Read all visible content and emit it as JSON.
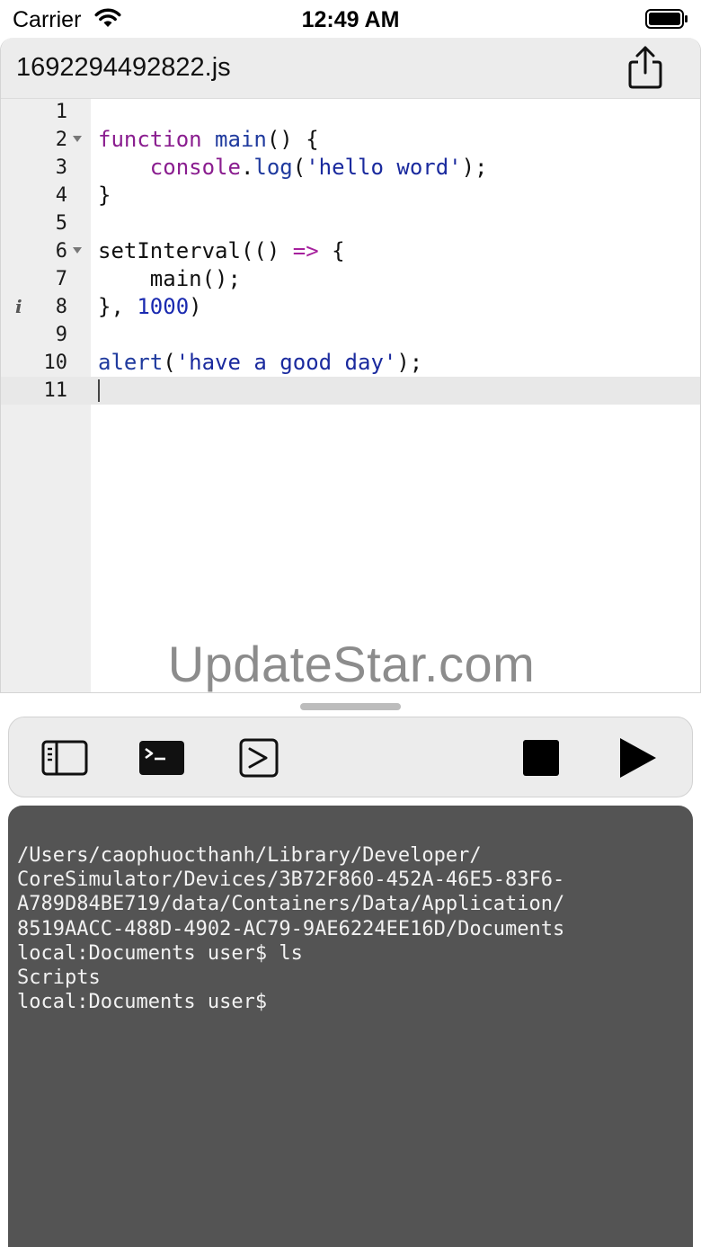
{
  "status_bar": {
    "carrier": "Carrier",
    "time": "12:49 AM",
    "wifi_icon": "wifi-icon",
    "battery_icon": "battery-icon"
  },
  "editor": {
    "file_name": "1692294492822.js",
    "share_icon": "share-icon",
    "lines": [
      {
        "number": "1",
        "tokens": []
      },
      {
        "number": "2",
        "fold": true,
        "tokens": [
          {
            "t": "function",
            "c": "kw"
          },
          {
            "t": " "
          },
          {
            "t": "main",
            "c": "fn"
          },
          {
            "t": "() {"
          }
        ]
      },
      {
        "number": "3",
        "tokens": [
          {
            "t": "    "
          },
          {
            "t": "console",
            "c": "kw"
          },
          {
            "t": "."
          },
          {
            "t": "log",
            "c": "fn"
          },
          {
            "t": "("
          },
          {
            "t": "'hello word'",
            "c": "str"
          },
          {
            "t": ");"
          }
        ]
      },
      {
        "number": "4",
        "tokens": [
          {
            "t": "}"
          }
        ]
      },
      {
        "number": "5",
        "tokens": []
      },
      {
        "number": "6",
        "fold": true,
        "tokens": [
          {
            "t": "setInterval(() "
          },
          {
            "t": "=>",
            "c": "op"
          },
          {
            "t": " {"
          }
        ]
      },
      {
        "number": "7",
        "tokens": [
          {
            "t": "    main();"
          }
        ]
      },
      {
        "number": "8",
        "info": "i",
        "tokens": [
          {
            "t": "}, "
          },
          {
            "t": "1000",
            "c": "num"
          },
          {
            "t": ")"
          }
        ]
      },
      {
        "number": "9",
        "tokens": []
      },
      {
        "number": "10",
        "tokens": [
          {
            "t": "alert",
            "c": "fn"
          },
          {
            "t": "("
          },
          {
            "t": "'have a good day'",
            "c": "str"
          },
          {
            "t": ");"
          }
        ]
      },
      {
        "number": "11",
        "active": true,
        "cursor": true,
        "tokens": []
      }
    ],
    "watermark": "UpdateStar.com"
  },
  "toolbar": {
    "sidebar_icon": "sidebar-icon",
    "terminal_icon": "terminal-icon",
    "console_icon": "console-icon",
    "stop_icon": "stop-icon",
    "play_icon": "play-icon"
  },
  "terminal": {
    "lines": [
      "/Users/caophuocthanh/Library/Developer/",
      "CoreSimulator/Devices/3B72F860-452A-46E5-83F6-",
      "A789D84BE719/data/Containers/Data/Application/",
      "8519AACC-488D-4902-AC79-9AE6224EE16D/Documents",
      "local:Documents user$ ls",
      "Scripts",
      "local:Documents user$"
    ]
  }
}
